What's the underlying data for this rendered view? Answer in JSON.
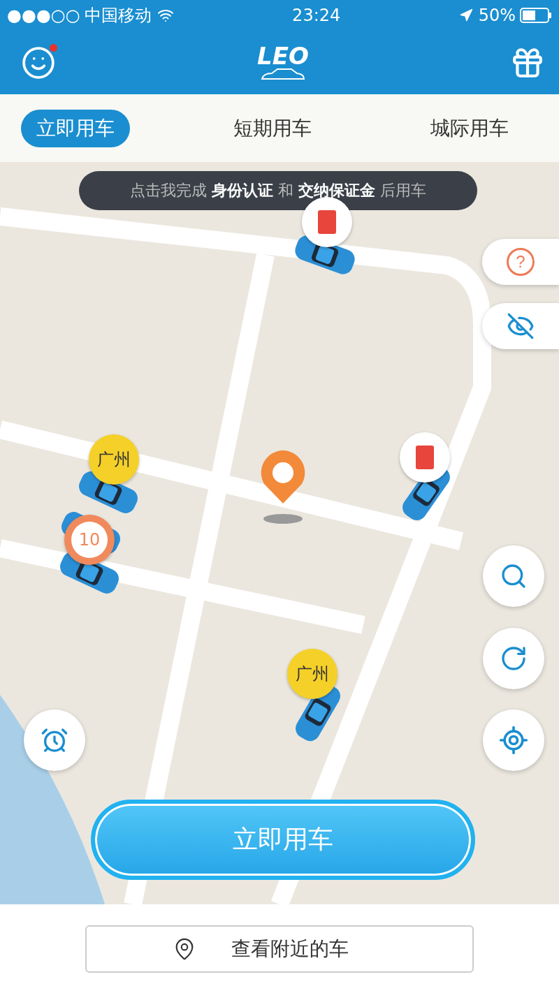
{
  "status_bar": {
    "signal": "●●●○○",
    "carrier": "中国移动",
    "time": "23:24",
    "battery": "50%"
  },
  "header": {
    "logo": "LEO",
    "avatar_notification": true
  },
  "tabs": [
    {
      "label": "立即用车",
      "selected": true
    },
    {
      "label": "短期用车",
      "selected": false
    },
    {
      "label": "城际用车",
      "selected": false
    }
  ],
  "notice": "点击我完成 **身份认证** 和 **交纳保证金** 后用车",
  "markers": [
    {
      "kind": "redpacket"
    },
    {
      "kind": "city",
      "label": "广州"
    },
    {
      "kind": "count",
      "label": "10"
    },
    {
      "kind": "redpacket"
    },
    {
      "kind": "city",
      "label": "广州"
    }
  ],
  "help_symbol": "?",
  "primary_button": "立即用车",
  "nearby_button": "查看附近的车"
}
